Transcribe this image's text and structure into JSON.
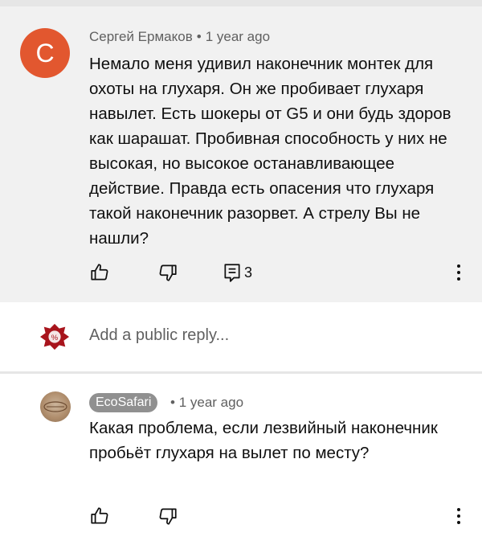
{
  "comment": {
    "avatar_letter": "С",
    "avatar_color": "#e2572f",
    "author": "Сергей Ермаков",
    "separator": "•",
    "time": "1 year ago",
    "text": "Немало меня удивил наконечник монтек для охоты на глухаря. Он же пробивает глухаря навылет. Есть шокеры от G5 и они будь здоров как шарашат. Пробивная способность у них не высокая, но высокое останавливающее действие. Правда есть опасения что глухаря такой наконечник разорвет. А стрелу Вы не нашли?",
    "reply_count": "3",
    "icons": [
      "like-icon",
      "dislike-icon",
      "reply-icon",
      "more-vert-icon"
    ]
  },
  "reply_box": {
    "placeholder": "Add a public reply..."
  },
  "reply": {
    "author_badge": "EcoSafari",
    "separator": "•",
    "time": "1 year ago",
    "text": "Какая проблема, если лезвийный наконечник пробьёт глухаря на вылет по месту?",
    "badge_color": "#909090",
    "icons": [
      "like-icon",
      "dislike-icon",
      "more-vert-icon"
    ]
  }
}
